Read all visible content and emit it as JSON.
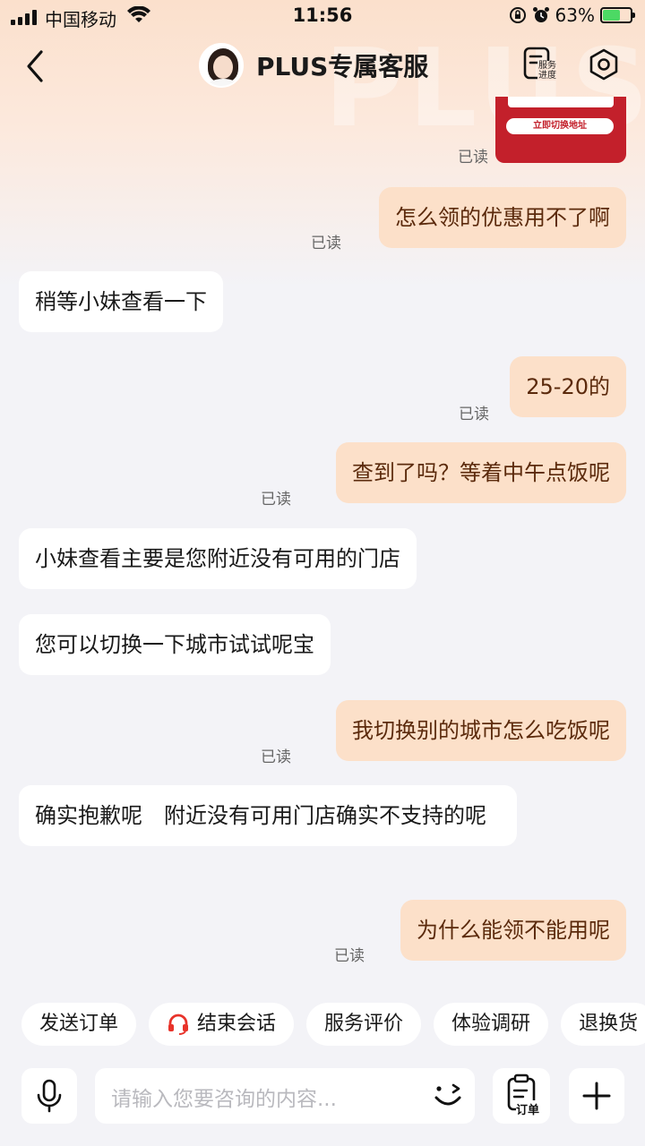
{
  "status_bar": {
    "carrier": "中国移动",
    "time": "11:56",
    "battery": "63%",
    "battery_level": 0.63
  },
  "nav": {
    "title": "PLUS专属客服",
    "watermark": "PLUS",
    "service_progress_label": "服务进度"
  },
  "card": {
    "button_label": "立即切换地址"
  },
  "messages": [
    {
      "side": "out",
      "text": "怎么领的优惠用不了啊",
      "read": "已读"
    },
    {
      "side": "in",
      "text": "稍等小妹查看一下"
    },
    {
      "side": "out",
      "text": "25-20的",
      "read": "已读"
    },
    {
      "side": "out",
      "text": "查到了吗？等着中午点饭呢",
      "read": "已读"
    },
    {
      "side": "in",
      "text": "小妹查看主要是您附近没有可用的门店"
    },
    {
      "side": "in",
      "text": "您可以切换一下城市试试呢宝"
    },
    {
      "side": "out",
      "text": "我切换别的城市怎么吃饭呢",
      "read": "已读"
    },
    {
      "side": "in",
      "text": "确实抱歉呢　附近没有可用门店确实不支持的呢"
    },
    {
      "side": "out",
      "text": "为什么能领不能用呢",
      "read": "已读"
    }
  ],
  "first_read": "已读",
  "quick_actions": [
    "发送订单",
    "结束会话",
    "服务评价",
    "体验调研",
    "退换货"
  ],
  "input": {
    "placeholder": "请输入您要咨询的内容...",
    "order_label": "订单"
  },
  "colors": {
    "outgoing_bubble": "#fce0c9",
    "incoming_bubble": "#ffffff",
    "header_gradient": "#fbe0cc",
    "accent_red": "#e8332a"
  }
}
